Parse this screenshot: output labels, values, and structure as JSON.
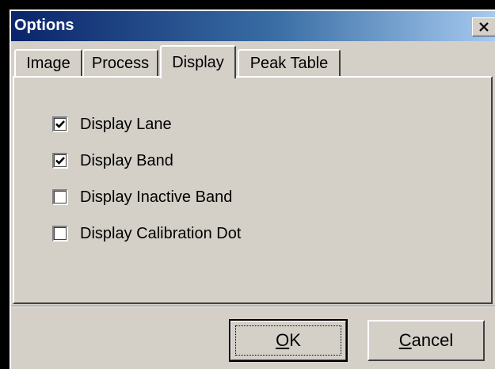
{
  "window": {
    "title": "Options",
    "close_glyph": "✕"
  },
  "tabs": [
    {
      "label": "Image",
      "active": false
    },
    {
      "label": "Process",
      "active": false
    },
    {
      "label": "Display",
      "active": true
    },
    {
      "label": "Peak Table",
      "active": false
    }
  ],
  "options": [
    {
      "label": "Display Lane",
      "checked": true
    },
    {
      "label": "Display Band",
      "checked": true
    },
    {
      "label": "Display Inactive Band",
      "checked": false
    },
    {
      "label": "Display Calibration Dot",
      "checked": false
    }
  ],
  "buttons": {
    "ok": {
      "mnemonic": "O",
      "rest": "K"
    },
    "cancel": {
      "mnemonic": "C",
      "rest": "ancel"
    }
  },
  "colors": {
    "face": "#d4d0c8",
    "title_start": "#0a246a",
    "title_end": "#a6caf0"
  }
}
